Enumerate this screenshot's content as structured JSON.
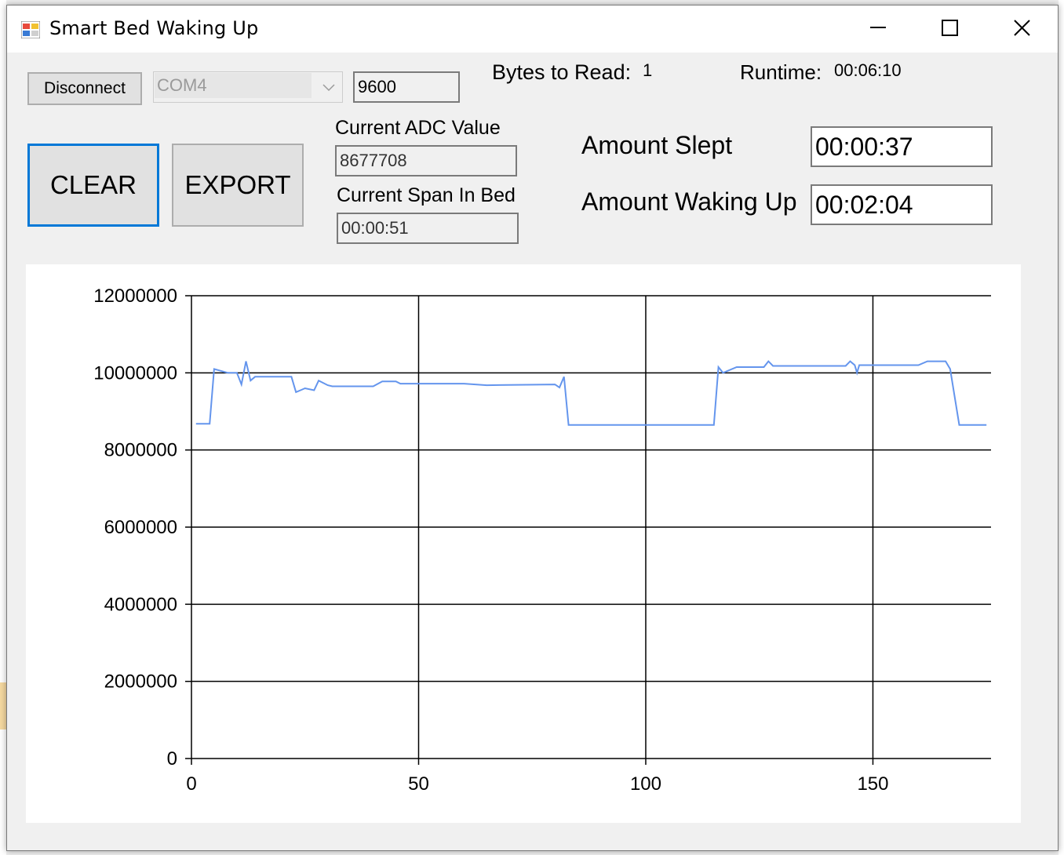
{
  "window": {
    "title": "Smart Bed Waking Up",
    "controls": {
      "minimize": "minimize-icon",
      "maximize": "maximize-icon",
      "close": "close-icon"
    }
  },
  "serial": {
    "disconnect_label": "Disconnect",
    "port_value": "COM4",
    "baud_value": "9600"
  },
  "status": {
    "bytes_label": "Bytes to Read:",
    "bytes_value": "1",
    "runtime_label": "Runtime:",
    "runtime_value": "00:06:10"
  },
  "actions": {
    "clear_label": "CLEAR",
    "export_label": "EXPORT"
  },
  "readings": {
    "adc_label": "Current ADC Value",
    "adc_value": "8677708",
    "span_label": "Current Span In Bed",
    "span_value": "00:00:51"
  },
  "summary": {
    "slept_label": "Amount Slept",
    "slept_value": "00:00:37",
    "waking_label": "Amount Waking Up",
    "waking_value": "00:02:04"
  },
  "colors": {
    "accent": "#0078d7",
    "series": "#6495ed"
  },
  "chart_data": {
    "type": "line",
    "xlim": [
      0,
      176
    ],
    "ylim": [
      0,
      12000000
    ],
    "xticks": [
      0,
      50,
      100,
      150
    ],
    "yticks": [
      0,
      2000000,
      4000000,
      6000000,
      8000000,
      10000000,
      12000000
    ],
    "grid": true,
    "series": [
      {
        "color": "#6495ed",
        "points": [
          [
            1,
            8680000
          ],
          [
            4,
            8680000
          ],
          [
            5,
            10100000
          ],
          [
            8,
            10000000
          ],
          [
            10,
            10000000
          ],
          [
            11,
            9700000
          ],
          [
            12,
            10300000
          ],
          [
            13,
            9800000
          ],
          [
            14,
            9900000
          ],
          [
            22,
            9900000
          ],
          [
            23,
            9500000
          ],
          [
            24,
            9550000
          ],
          [
            25,
            9600000
          ],
          [
            27,
            9550000
          ],
          [
            28,
            9800000
          ],
          [
            30,
            9680000
          ],
          [
            31,
            9650000
          ],
          [
            40,
            9650000
          ],
          [
            42,
            9780000
          ],
          [
            45,
            9780000
          ],
          [
            46,
            9720000
          ],
          [
            60,
            9720000
          ],
          [
            65,
            9680000
          ],
          [
            80,
            9700000
          ],
          [
            81,
            9620000
          ],
          [
            82,
            9900000
          ],
          [
            83,
            8650000
          ],
          [
            115,
            8650000
          ],
          [
            116,
            10150000
          ],
          [
            117,
            10000000
          ],
          [
            120,
            10150000
          ],
          [
            126,
            10150000
          ],
          [
            127,
            10300000
          ],
          [
            128,
            10180000
          ],
          [
            144,
            10180000
          ],
          [
            145,
            10300000
          ],
          [
            146,
            10200000
          ],
          [
            146.5,
            10000000
          ],
          [
            147,
            10200000
          ],
          [
            160,
            10200000
          ],
          [
            162,
            10300000
          ],
          [
            166,
            10300000
          ],
          [
            167,
            10100000
          ],
          [
            169,
            8650000
          ],
          [
            175,
            8650000
          ]
        ]
      }
    ]
  }
}
